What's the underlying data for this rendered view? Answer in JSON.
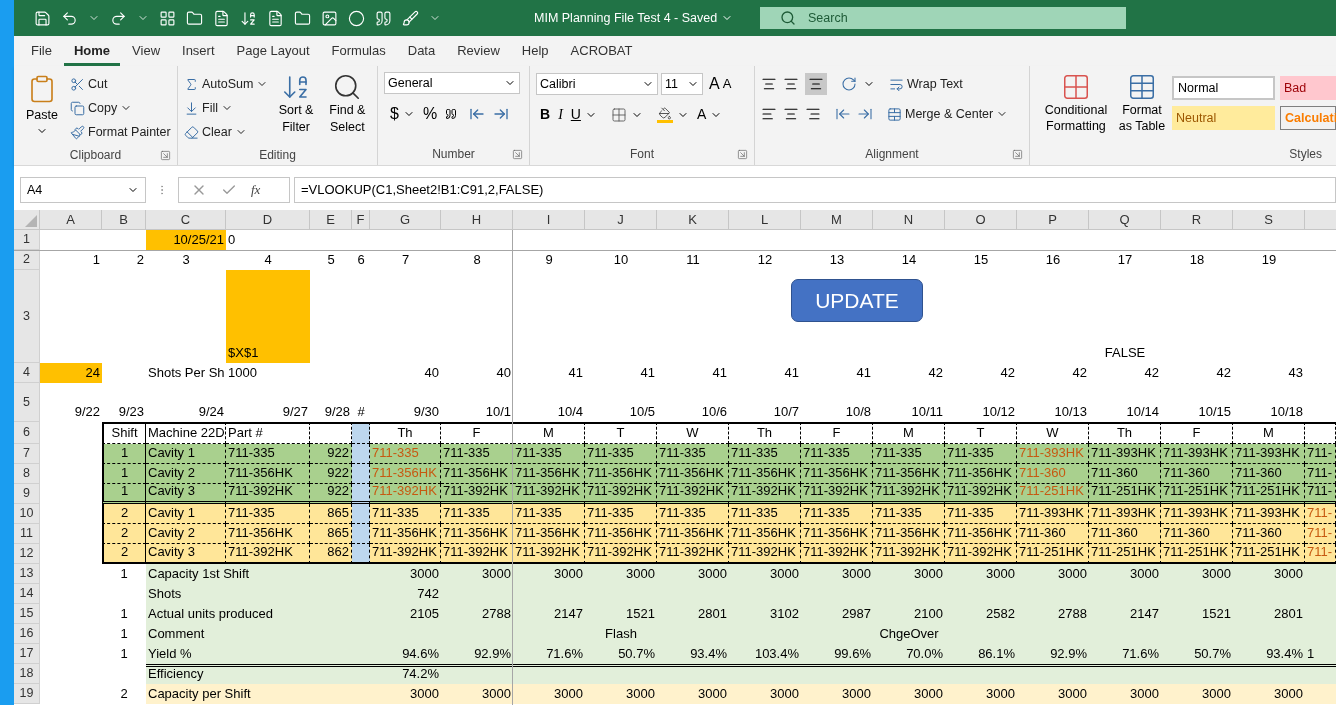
{
  "title_bar": {
    "document": "MIM Planning File Test 4  -  Saved",
    "search_placeholder": "Search"
  },
  "menu_tabs": [
    {
      "label": "File",
      "selected": false
    },
    {
      "label": "Home",
      "selected": true
    },
    {
      "label": "View",
      "selected": false
    },
    {
      "label": "Insert",
      "selected": false
    },
    {
      "label": "Page Layout",
      "selected": false
    },
    {
      "label": "Formulas",
      "selected": false
    },
    {
      "label": "Data",
      "selected": false
    },
    {
      "label": "Review",
      "selected": false
    },
    {
      "label": "Help",
      "selected": false
    },
    {
      "label": "ACROBAT",
      "selected": false
    }
  ],
  "ribbon": {
    "clipboard": {
      "paste": "Paste",
      "cut": "Cut",
      "copy": "Copy",
      "format_painter": "Format Painter",
      "label": "Clipboard"
    },
    "editing": {
      "autosum": "AutoSum",
      "fill": "Fill",
      "clear": "Clear",
      "sort_filter": "Sort & Filter",
      "find_select": "Find & Select",
      "label": "Editing"
    },
    "number": {
      "format": "General",
      "currency": "$",
      "percent": "%",
      "label": "Number"
    },
    "font": {
      "family": "Calibri",
      "size": "11",
      "grow": "A",
      "shrink": "A",
      "bold": "B",
      "italic": "I",
      "underline": "U",
      "font_color": "A",
      "label": "Font"
    },
    "alignment": {
      "wrap_text": "Wrap Text",
      "merge_center": "Merge & Center",
      "label": "Alignment"
    },
    "styles": {
      "conditional_formatting": "Conditional Formatting",
      "format_as_table": "Format as Table",
      "label": "Styles",
      "cell_styles": [
        {
          "label": "Normal",
          "kind": "normal"
        },
        {
          "label": "Bad",
          "kind": "bad"
        },
        {
          "label": "Neutral",
          "kind": "neutral"
        },
        {
          "label": "Calculati",
          "kind": "calculation"
        }
      ]
    }
  },
  "formula_bar": {
    "name_box": "A4",
    "function_label": "fx",
    "formula": "=VLOOKUP(C1,Sheet2!B1:C91,2,FALSE)"
  },
  "sheet": {
    "columns": [
      "A",
      "B",
      "C",
      "D",
      "E",
      "F",
      "G",
      "H",
      "I",
      "J",
      "K",
      "L",
      "M",
      "N",
      "O",
      "P",
      "Q",
      "R",
      "S"
    ],
    "button": "UPDATE",
    "rows": [
      {
        "number": "1",
        "kind": "plain",
        "cells": [
          null,
          null,
          {
            "text": "10/25/21",
            "kind": "num",
            "color": "#ffc000"
          },
          {
            "text": "0",
            "kind": "text"
          }
        ]
      },
      {
        "number": "2",
        "kind": "plain",
        "cells": [
          {
            "text": "1",
            "kind": "num"
          },
          {
            "text": "2",
            "kind": "num"
          },
          {
            "text": "3",
            "kind": "center"
          },
          {
            "text": "4",
            "kind": "center"
          },
          {
            "text": "5",
            "kind": "center"
          },
          {
            "text": "6",
            "kind": "center"
          },
          {
            "text": "7",
            "kind": "center"
          },
          {
            "text": "8",
            "kind": "center"
          },
          {
            "text": "9",
            "kind": "center"
          },
          {
            "text": "10",
            "kind": "center"
          },
          {
            "text": "11",
            "kind": "center"
          },
          {
            "text": "12",
            "kind": "center"
          },
          {
            "text": "13",
            "kind": "center"
          },
          {
            "text": "14",
            "kind": "center"
          },
          {
            "text": "15",
            "kind": "center"
          },
          {
            "text": "16",
            "kind": "center"
          },
          {
            "text": "17",
            "kind": "center"
          },
          {
            "text": "18",
            "kind": "center"
          },
          {
            "text": "19",
            "kind": "center"
          }
        ]
      },
      {
        "number": "3",
        "kind": "plain",
        "cells": [
          null,
          null,
          null,
          {
            "text": "$X$1",
            "kind": "text",
            "color": "#ffc000"
          },
          null,
          null,
          null,
          null,
          null,
          null,
          null,
          null,
          null,
          null,
          null,
          null,
          {
            "text": "FALSE",
            "kind": "center"
          }
        ]
      },
      {
        "number": "4",
        "kind": "plain",
        "cells": [
          {
            "text": "24",
            "kind": "num",
            "color": "#ffc000"
          },
          null,
          {
            "text": "Shots Per Sh",
            "kind": "text"
          },
          {
            "text": "1000",
            "kind": "text"
          },
          null,
          null,
          {
            "text": "40",
            "kind": "num"
          },
          {
            "text": "40",
            "kind": "num"
          },
          {
            "text": "41",
            "kind": "num"
          },
          {
            "text": "41",
            "kind": "num"
          },
          {
            "text": "41",
            "kind": "num"
          },
          {
            "text": "41",
            "kind": "num"
          },
          {
            "text": "41",
            "kind": "num"
          },
          {
            "text": "42",
            "kind": "num"
          },
          {
            "text": "42",
            "kind": "num"
          },
          {
            "text": "42",
            "kind": "num"
          },
          {
            "text": "42",
            "kind": "num"
          },
          {
            "text": "42",
            "kind": "num"
          },
          {
            "text": "43",
            "kind": "num"
          }
        ]
      },
      {
        "number": "5",
        "kind": "plain",
        "cells": [
          {
            "text": "9/22",
            "kind": "num"
          },
          {
            "text": "9/23",
            "kind": "num"
          },
          {
            "text": "9/24",
            "kind": "num"
          },
          {
            "text": "9/27",
            "kind": "num"
          },
          {
            "text": "9/28",
            "kind": "num"
          },
          {
            "text": "#",
            "kind": "center"
          },
          {
            "text": "9/30",
            "kind": "num"
          },
          {
            "text": "10/1",
            "kind": "num"
          },
          {
            "text": "10/4",
            "kind": "num"
          },
          {
            "text": "10/5",
            "kind": "num"
          },
          {
            "text": "10/6",
            "kind": "num"
          },
          {
            "text": "10/7",
            "kind": "num"
          },
          {
            "text": "10/8",
            "kind": "num"
          },
          {
            "text": "10/11",
            "kind": "num"
          },
          {
            "text": "10/12",
            "kind": "num"
          },
          {
            "text": "10/13",
            "kind": "num"
          },
          {
            "text": "10/14",
            "kind": "num"
          },
          {
            "text": "10/15",
            "kind": "num"
          },
          {
            "text": "10/18",
            "kind": "num"
          }
        ]
      },
      {
        "number": "6",
        "kind": "table_head",
        "cells": [
          null,
          {
            "text": "Shift",
            "kind": "center"
          },
          {
            "text": "Machine 22D",
            "kind": "text"
          },
          {
            "text": "Part #",
            "kind": "text"
          },
          null,
          {
            "kind": "blank",
            "color": "#bdd7ee"
          },
          {
            "text": "Th",
            "kind": "center"
          },
          {
            "text": "F",
            "kind": "center"
          },
          {
            "text": "M",
            "kind": "center"
          },
          {
            "text": "T",
            "kind": "center"
          },
          {
            "text": "W",
            "kind": "center"
          },
          {
            "text": "Th",
            "kind": "center"
          },
          {
            "text": "F",
            "kind": "center"
          },
          {
            "text": "M",
            "kind": "center"
          },
          {
            "text": "T",
            "kind": "center"
          },
          {
            "text": "W",
            "kind": "center"
          },
          {
            "text": "Th",
            "kind": "center"
          },
          {
            "text": "F",
            "kind": "center"
          },
          {
            "text": "M",
            "kind": "center"
          },
          null
        ]
      },
      {
        "number": "7",
        "kind": "shift1",
        "cells": [
          null,
          {
            "text": "1",
            "kind": "center"
          },
          {
            "text": "Cavity 1",
            "kind": "text"
          },
          {
            "text": "711-335",
            "kind": "text"
          },
          {
            "text": "922",
            "kind": "num"
          },
          {
            "kind": "blank",
            "color": "#bdd7ee"
          },
          {
            "text": "711-335",
            "kind": "text",
            "changed": true
          },
          {
            "text": "711-335",
            "kind": "text",
            "changed": false
          },
          {
            "text": "711-335",
            "kind": "text",
            "changed": false
          },
          {
            "text": "711-335",
            "kind": "text",
            "changed": false
          },
          {
            "text": "711-335",
            "kind": "text",
            "changed": false
          },
          {
            "text": "711-335",
            "kind": "text",
            "changed": false
          },
          {
            "text": "711-335",
            "kind": "text",
            "changed": false
          },
          {
            "text": "711-335",
            "kind": "text",
            "changed": false
          },
          {
            "text": "711-335",
            "kind": "text",
            "changed": false
          },
          {
            "text": "711-393HK",
            "kind": "text",
            "changed": true
          },
          {
            "text": "711-393HK",
            "kind": "text",
            "changed": false
          },
          {
            "text": "711-393HK",
            "kind": "text",
            "changed": false
          },
          {
            "text": "711-393HK",
            "kind": "text",
            "changed": false
          },
          {
            "text": "711-",
            "kind": "text",
            "changed": false
          }
        ]
      },
      {
        "number": "8",
        "kind": "shift1",
        "cells": [
          null,
          {
            "text": "1",
            "kind": "center"
          },
          {
            "text": "Cavity 2",
            "kind": "text"
          },
          {
            "text": "711-356HK",
            "kind": "text"
          },
          {
            "text": "922",
            "kind": "num"
          },
          {
            "kind": "blank",
            "color": "#bdd7ee"
          },
          {
            "text": "711-356HK",
            "kind": "text",
            "changed": true
          },
          {
            "text": "711-356HK",
            "kind": "text",
            "changed": false
          },
          {
            "text": "711-356HK",
            "kind": "text",
            "changed": false
          },
          {
            "text": "711-356HK",
            "kind": "text",
            "changed": false
          },
          {
            "text": "711-356HK",
            "kind": "text",
            "changed": false
          },
          {
            "text": "711-356HK",
            "kind": "text",
            "changed": false
          },
          {
            "text": "711-356HK",
            "kind": "text",
            "changed": false
          },
          {
            "text": "711-356HK",
            "kind": "text",
            "changed": false
          },
          {
            "text": "711-356HK",
            "kind": "text",
            "changed": false
          },
          {
            "text": "711-360",
            "kind": "text",
            "changed": true
          },
          {
            "text": "711-360",
            "kind": "text",
            "changed": false
          },
          {
            "text": "711-360",
            "kind": "text",
            "changed": false
          },
          {
            "text": "711-360",
            "kind": "text",
            "changed": false
          },
          {
            "text": "711-",
            "kind": "text",
            "changed": false
          }
        ]
      },
      {
        "number": "9",
        "kind": "shift1",
        "cells": [
          null,
          {
            "text": "1",
            "kind": "center"
          },
          {
            "text": "Cavity 3",
            "kind": "text"
          },
          {
            "text": "711-392HK",
            "kind": "text"
          },
          {
            "text": "922",
            "kind": "num"
          },
          {
            "kind": "blank",
            "color": "#bdd7ee"
          },
          {
            "text": "711-392HK",
            "kind": "text",
            "changed": true
          },
          {
            "text": "711-392HK",
            "kind": "text",
            "changed": false
          },
          {
            "text": "711-392HK",
            "kind": "text",
            "changed": false
          },
          {
            "text": "711-392HK",
            "kind": "text",
            "changed": false
          },
          {
            "text": "711-392HK",
            "kind": "text",
            "changed": false
          },
          {
            "text": "711-392HK",
            "kind": "text",
            "changed": false
          },
          {
            "text": "711-392HK",
            "kind": "text",
            "changed": false
          },
          {
            "text": "711-392HK",
            "kind": "text",
            "changed": false
          },
          {
            "text": "711-392HK",
            "kind": "text",
            "changed": false
          },
          {
            "text": "711-251HK",
            "kind": "text",
            "changed": true
          },
          {
            "text": "711-251HK",
            "kind": "text",
            "changed": false
          },
          {
            "text": "711-251HK",
            "kind": "text",
            "changed": false
          },
          {
            "text": "711-251HK",
            "kind": "text",
            "changed": false
          },
          {
            "text": "711-",
            "kind": "text",
            "changed": false
          }
        ]
      },
      {
        "number": "10",
        "kind": "shift2",
        "cells": [
          null,
          {
            "text": "2",
            "kind": "center"
          },
          {
            "text": "Cavity 1",
            "kind": "text"
          },
          {
            "text": "711-335",
            "kind": "text"
          },
          {
            "text": "865",
            "kind": "num"
          },
          {
            "kind": "blank",
            "color": "#bdd7ee"
          },
          {
            "text": "711-335",
            "kind": "text",
            "changed": false
          },
          {
            "text": "711-335",
            "kind": "text",
            "changed": false
          },
          {
            "text": "711-335",
            "kind": "text",
            "changed": false
          },
          {
            "text": "711-335",
            "kind": "text",
            "changed": false
          },
          {
            "text": "711-335",
            "kind": "text",
            "changed": false
          },
          {
            "text": "711-335",
            "kind": "text",
            "changed": false
          },
          {
            "text": "711-335",
            "kind": "text",
            "changed": false
          },
          {
            "text": "711-335",
            "kind": "text",
            "changed": false
          },
          {
            "text": "711-335",
            "kind": "text",
            "changed": false
          },
          {
            "text": "711-393HK",
            "kind": "text",
            "changed": false
          },
          {
            "text": "711-393HK",
            "kind": "text",
            "changed": false
          },
          {
            "text": "711-393HK",
            "kind": "text",
            "changed": false
          },
          {
            "text": "711-393HK",
            "kind": "text",
            "changed": false
          },
          {
            "text": "711-",
            "kind": "text",
            "changed": true
          }
        ]
      },
      {
        "number": "11",
        "kind": "shift2",
        "cells": [
          null,
          {
            "text": "2",
            "kind": "center"
          },
          {
            "text": "Cavity 2",
            "kind": "text"
          },
          {
            "text": "711-356HK",
            "kind": "text"
          },
          {
            "text": "865",
            "kind": "num"
          },
          {
            "kind": "blank",
            "color": "#bdd7ee"
          },
          {
            "text": "711-356HK",
            "kind": "text",
            "changed": false
          },
          {
            "text": "711-356HK",
            "kind": "text",
            "changed": false
          },
          {
            "text": "711-356HK",
            "kind": "text",
            "changed": false
          },
          {
            "text": "711-356HK",
            "kind": "text",
            "changed": false
          },
          {
            "text": "711-356HK",
            "kind": "text",
            "changed": false
          },
          {
            "text": "711-356HK",
            "kind": "text",
            "changed": false
          },
          {
            "text": "711-356HK",
            "kind": "text",
            "changed": false
          },
          {
            "text": "711-356HK",
            "kind": "text",
            "changed": false
          },
          {
            "text": "711-356HK",
            "kind": "text",
            "changed": false
          },
          {
            "text": "711-360",
            "kind": "text",
            "changed": false
          },
          {
            "text": "711-360",
            "kind": "text",
            "changed": false
          },
          {
            "text": "711-360",
            "kind": "text",
            "changed": false
          },
          {
            "text": "711-360",
            "kind": "text",
            "changed": false
          },
          {
            "text": "711-",
            "kind": "text",
            "changed": true
          }
        ]
      },
      {
        "number": "12",
        "kind": "shift2",
        "cells": [
          null,
          {
            "text": "2",
            "kind": "center"
          },
          {
            "text": "Cavity 3",
            "kind": "text"
          },
          {
            "text": "711-392HK",
            "kind": "text"
          },
          {
            "text": "862",
            "kind": "num"
          },
          {
            "kind": "blank",
            "color": "#bdd7ee"
          },
          {
            "text": "711-392HK",
            "kind": "text",
            "changed": false
          },
          {
            "text": "711-392HK",
            "kind": "text",
            "changed": false
          },
          {
            "text": "711-392HK",
            "kind": "text",
            "changed": false
          },
          {
            "text": "711-392HK",
            "kind": "text",
            "changed": false
          },
          {
            "text": "711-392HK",
            "kind": "text",
            "changed": false
          },
          {
            "text": "711-392HK",
            "kind": "text",
            "changed": false
          },
          {
            "text": "711-392HK",
            "kind": "text",
            "changed": false
          },
          {
            "text": "711-392HK",
            "kind": "text",
            "changed": false
          },
          {
            "text": "711-392HK",
            "kind": "text",
            "changed": false
          },
          {
            "text": "711-251HK",
            "kind": "text",
            "changed": false
          },
          {
            "text": "711-251HK",
            "kind": "text",
            "changed": false
          },
          {
            "text": "711-251HK",
            "kind": "text",
            "changed": false
          },
          {
            "text": "711-251HK",
            "kind": "text",
            "changed": false
          },
          {
            "text": "711-",
            "kind": "text",
            "changed": true
          }
        ]
      },
      {
        "number": "13",
        "kind": "summary1",
        "cells": [
          null,
          {
            "text": "1",
            "kind": "center"
          },
          {
            "text": "Capacity 1st Shift",
            "kind": "text"
          },
          null,
          null,
          null,
          {
            "text": "3000",
            "kind": "num"
          },
          {
            "text": "3000",
            "kind": "num"
          },
          {
            "text": "3000",
            "kind": "num"
          },
          {
            "text": "3000",
            "kind": "num"
          },
          {
            "text": "3000",
            "kind": "num"
          },
          {
            "text": "3000",
            "kind": "num"
          },
          {
            "text": "3000",
            "kind": "num"
          },
          {
            "text": "3000",
            "kind": "num"
          },
          {
            "text": "3000",
            "kind": "num"
          },
          {
            "text": "3000",
            "kind": "num"
          },
          {
            "text": "3000",
            "kind": "num"
          },
          {
            "text": "3000",
            "kind": "num"
          },
          {
            "text": "3000",
            "kind": "num"
          }
        ]
      },
      {
        "number": "14",
        "kind": "summary1",
        "cells": [
          null,
          null,
          {
            "text": "Shots",
            "kind": "text"
          },
          null,
          null,
          null,
          {
            "text": "742",
            "kind": "num"
          }
        ]
      },
      {
        "number": "15",
        "kind": "summary1",
        "cells": [
          null,
          {
            "text": "1",
            "kind": "center"
          },
          {
            "text": "Actual units produced",
            "kind": "text"
          },
          null,
          null,
          null,
          {
            "text": "2105",
            "kind": "num"
          },
          {
            "text": "2788",
            "kind": "num"
          },
          {
            "text": "2147",
            "kind": "num"
          },
          {
            "text": "1521",
            "kind": "num"
          },
          {
            "text": "2801",
            "kind": "num"
          },
          {
            "text": "3102",
            "kind": "num"
          },
          {
            "text": "2987",
            "kind": "num"
          },
          {
            "text": "2100",
            "kind": "num"
          },
          {
            "text": "2582",
            "kind": "num"
          },
          {
            "text": "2788",
            "kind": "num"
          },
          {
            "text": "2147",
            "kind": "num"
          },
          {
            "text": "1521",
            "kind": "num"
          },
          {
            "text": "2801",
            "kind": "num"
          }
        ]
      },
      {
        "number": "16",
        "kind": "summary1",
        "cells": [
          null,
          {
            "text": "1",
            "kind": "center"
          },
          {
            "text": "Comment",
            "kind": "text"
          },
          null,
          null,
          null,
          null,
          null,
          null,
          {
            "text": "Flash",
            "kind": "center"
          },
          null,
          null,
          null,
          {
            "text": "ChgeOver",
            "kind": "center"
          }
        ]
      },
      {
        "number": "17",
        "kind": "summary1",
        "cells": [
          null,
          {
            "text": "1",
            "kind": "center"
          },
          {
            "text": "Yield %",
            "kind": "text"
          },
          null,
          null,
          null,
          {
            "text": "94.6%",
            "kind": "num"
          },
          {
            "text": "92.9%",
            "kind": "num"
          },
          {
            "text": "71.6%",
            "kind": "num"
          },
          {
            "text": "50.7%",
            "kind": "num"
          },
          {
            "text": "93.4%",
            "kind": "num"
          },
          {
            "text": "103.4%",
            "kind": "num"
          },
          {
            "text": "99.6%",
            "kind": "num"
          },
          {
            "text": "70.0%",
            "kind": "num"
          },
          {
            "text": "86.1%",
            "kind": "num"
          },
          {
            "text": "92.9%",
            "kind": "num"
          },
          {
            "text": "71.6%",
            "kind": "num"
          },
          {
            "text": "50.7%",
            "kind": "num"
          },
          {
            "text": "93.4%",
            "kind": "num"
          },
          {
            "text": "1",
            "kind": "text"
          }
        ]
      },
      {
        "number": "18",
        "kind": "total1",
        "cells": [
          null,
          null,
          {
            "text": "Efficiency",
            "kind": "text"
          },
          null,
          null,
          null,
          {
            "text": "74.2%",
            "kind": "num"
          }
        ]
      },
      {
        "number": "19",
        "kind": "summary2",
        "cells": [
          null,
          {
            "text": "2",
            "kind": "center"
          },
          {
            "text": "Capacity per Shift",
            "kind": "text"
          },
          null,
          null,
          null,
          {
            "text": "3000",
            "kind": "num"
          },
          {
            "text": "3000",
            "kind": "num"
          },
          {
            "text": "3000",
            "kind": "num"
          },
          {
            "text": "3000",
            "kind": "num"
          },
          {
            "text": "3000",
            "kind": "num"
          },
          {
            "text": "3000",
            "kind": "num"
          },
          {
            "text": "3000",
            "kind": "num"
          },
          {
            "text": "3000",
            "kind": "num"
          },
          {
            "text": "3000",
            "kind": "num"
          },
          {
            "text": "3000",
            "kind": "num"
          },
          {
            "text": "3000",
            "kind": "num"
          },
          {
            "text": "3000",
            "kind": "num"
          },
          {
            "text": "3000",
            "kind": "num"
          }
        ]
      }
    ]
  }
}
